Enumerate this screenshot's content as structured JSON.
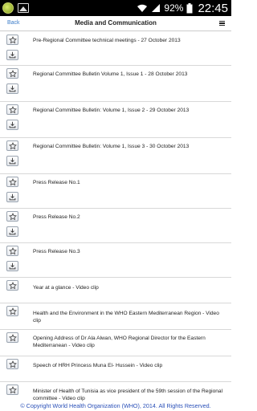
{
  "status_bar": {
    "battery": "92%",
    "time": "22:45"
  },
  "header": {
    "back_label": "Back",
    "title": "Media and Communication",
    "menu_icon": "hamburger-menu-icon"
  },
  "items": [
    {
      "title": "Pre-Regional Committee technical meetings - 27 October 2013",
      "has_download": true
    },
    {
      "title": "Regional Committee Bulletin Volume 1, Issue 1 - 28 October 2013",
      "has_download": true
    },
    {
      "title": "Regional Committee Bulletin: Volume 1, Issue 2 - 29 October 2013",
      "has_download": true
    },
    {
      "title": "Regional Committee Bulletin: Volume 1, Issue 3 - 30 October 2013",
      "has_download": true
    },
    {
      "title": "Press Release No.1",
      "has_download": true
    },
    {
      "title": "Press Release No.2",
      "has_download": true
    },
    {
      "title": "Press Release No.3",
      "has_download": true
    },
    {
      "title": "Year at a glance - Video clip",
      "has_download": false
    },
    {
      "title": "Health and the Environment in the WHO Eastern Mediterranean Region - Video clip",
      "has_download": false
    },
    {
      "title": "Opening Address of Dr Ala Alwan, WHO Regional Director for the Eastern Mediterranean - Video clip",
      "has_download": false
    },
    {
      "title": "Speech of HRH Princess Muna El- Hussein - Video clip",
      "has_download": false
    },
    {
      "title": "Minister of Health of Tunisia as vice president of the 59th session of the Regional committee - Video clip",
      "has_download": false
    }
  ],
  "footer": {
    "copyright": "© Copyright World Health Organization (WHO), 2014. All Rights Reserved."
  }
}
